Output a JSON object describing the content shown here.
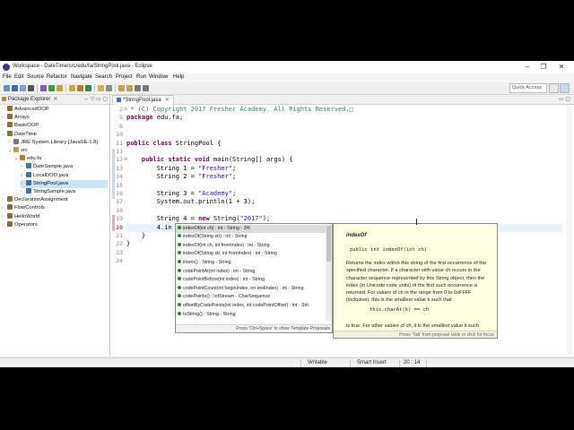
{
  "window": {
    "title": "Workspace - DateTime/src/edu/fa/StringPool.java - Eclipse",
    "controls": [
      "–",
      "❐",
      "✕"
    ]
  },
  "menu": [
    "File",
    "Edit",
    "Source",
    "Refactor",
    "Navigate",
    "Search",
    "Project",
    "Run",
    "Window",
    "Help"
  ],
  "toolbar": {
    "quick_access": "Quick Access"
  },
  "package_explorer": {
    "tab_label": "Package Explorer",
    "items": [
      {
        "label": "AdvancedOOP",
        "icon": "project-icon",
        "level": 0,
        "expanded": false
      },
      {
        "label": "Arrays",
        "icon": "project-icon",
        "level": 0,
        "expanded": false
      },
      {
        "label": "BasicOOP",
        "icon": "project-icon",
        "level": 0,
        "expanded": false
      },
      {
        "label": "DateTime",
        "icon": "project-icon",
        "level": 0,
        "expanded": true
      },
      {
        "label": "JRE System Library [JavaSE-1.8]",
        "icon": "library-icon",
        "level": 1,
        "expanded": false
      },
      {
        "label": "src",
        "icon": "source-folder-icon",
        "level": 1,
        "expanded": true
      },
      {
        "label": "edu.fa",
        "icon": "package-icon",
        "level": 2,
        "expanded": true
      },
      {
        "label": "DateSample.java",
        "icon": "java-file-icon",
        "level": 3,
        "expanded": false
      },
      {
        "label": "LocalDOO.java",
        "icon": "java-file-icon",
        "level": 3,
        "expanded": false
      },
      {
        "label": "StringPool.java",
        "icon": "java-file-icon",
        "level": 3,
        "expanded": false,
        "selected": true
      },
      {
        "label": "StringSample.java",
        "icon": "java-file-icon",
        "level": 3,
        "expanded": false
      },
      {
        "label": "DeclarationAssignment",
        "icon": "project-icon",
        "level": 0,
        "expanded": false
      },
      {
        "label": "FlowControls",
        "icon": "project-icon",
        "level": 0,
        "expanded": false
      },
      {
        "label": "HelloWorld",
        "icon": "project-icon",
        "level": 0,
        "expanded": false
      },
      {
        "label": "Operators",
        "icon": "project-icon",
        "level": 0,
        "expanded": false
      }
    ]
  },
  "editor": {
    "tab_label": "*StringPool.java",
    "lines": [
      {
        "n": "2",
        "marker": "⊖",
        "text": " * (C) Copyright 2017 Fresher Academy. All Rights Reserved.□"
      },
      {
        "n": "5",
        "text": "package edu.fa;"
      },
      {
        "n": "6",
        "text": ""
      },
      {
        "n": "10",
        "text": ""
      },
      {
        "n": "11",
        "text": "public class StringPool {"
      },
      {
        "n": "11",
        "text": ""
      },
      {
        "n": "12",
        "marker": "⊖",
        "text": "    public static void main(String[] args) {"
      },
      {
        "n": "13",
        "text": "        String s1 = \"Fresher\";"
      },
      {
        "n": "14",
        "text": "        String s2 = \"Fresher\";"
      },
      {
        "n": "15",
        "text": ""
      },
      {
        "n": "16",
        "text": "        String s3 = \"Academy\";"
      },
      {
        "n": "17",
        "text": "        System.out.println(s1 + s3);"
      },
      {
        "n": "18",
        "text": ""
      },
      {
        "n": "19",
        "text": "        String s4 = new String(\"2017\");"
      },
      {
        "n": "20",
        "text": "        s4.in"
      },
      {
        "n": "21",
        "text": "    }"
      },
      {
        "n": "22",
        "text": "}"
      },
      {
        "n": "23",
        "text": ""
      },
      {
        "n": "24",
        "text": ""
      }
    ]
  },
  "content_assist": {
    "items": [
      "indexOf(int ch) : int - String - 3%",
      "indexOf(String str) : int - String",
      "indexOf(int ch, int fromIndex) : int - String",
      "indexOf(String str, int fromIndex) : int - String",
      "intern() : String - String",
      "codePointAt(int index) : int - String",
      "codePointBefore(int index) : int - String",
      "codePointCount(int beginIndex, int endIndex) : int - String",
      "codePoints() : IntStream - CharSequence",
      "offsetByCodePoints(int index, int codePointOffset) : int - Stri",
      "toString() : String - String"
    ],
    "status": "Press 'Ctrl+Space' to show Template Proposals"
  },
  "javadoc": {
    "title": "indexOf",
    "signature": "public int indexOf(int ch)",
    "description": "Returns the index within this string of the first occurrence of the specified character. If a character with value ch occurs in the character sequence represented by this String object, then the index (in Unicode code units) of the first such occurrence is returned. For values of ch in the range from 0 to 0xFFFF (inclusive), this is the smallest value k such that:",
    "code": "this.charAt(k) == ch",
    "more": "is true. For other values of ch, it is the smallest value k such",
    "status": "Press 'Tab' from proposal table or click for focus"
  },
  "statusbar": {
    "mode": "Writable",
    "insert": "Smart Insert",
    "position": "20 : 14"
  }
}
